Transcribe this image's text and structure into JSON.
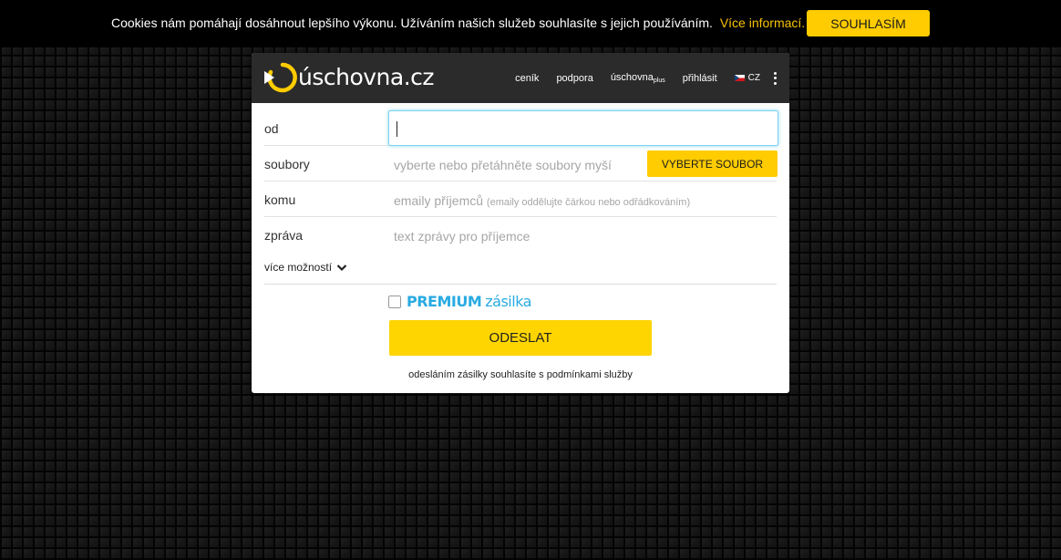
{
  "cookie": {
    "text": "Cookies nám pomáhají dosáhnout lepšího výkonu. Užíváním našich služeb souhlasíte s jejich používáním.",
    "link": "Více informací.",
    "accept": "SOUHLASÍM"
  },
  "header": {
    "logo_text": "úschovna.cz",
    "nav": {
      "pricing": "ceník",
      "support": "podpora",
      "plus_main": "úschovna",
      "plus_sub": "plus",
      "login": "přihlásit",
      "language": "CZ"
    }
  },
  "form": {
    "from_label": "od",
    "from_value": "",
    "files_label": "soubory",
    "files_placeholder": "vyberte nebo přetáhněte soubory myší",
    "select_files": "VYBERTE SOUBOR",
    "to_label": "komu",
    "to_placeholder": "emaily příjemců",
    "to_hint": "(emaily oddělujte čárkou nebo odřádkováním)",
    "message_label": "zpráva",
    "message_placeholder": "text zprávy pro příjemce",
    "more_options": "více možností",
    "premium_word": "PREMIUM",
    "premium_suffix": "zásilka",
    "premium_checked": false,
    "send": "ODESLAT",
    "terms": "odesláním zásilky souhlasíte s podmínkami služby"
  },
  "colors": {
    "accent_yellow": "#fecc00",
    "premium_blue": "#29abe2",
    "header_dark": "#2b2b2b"
  }
}
